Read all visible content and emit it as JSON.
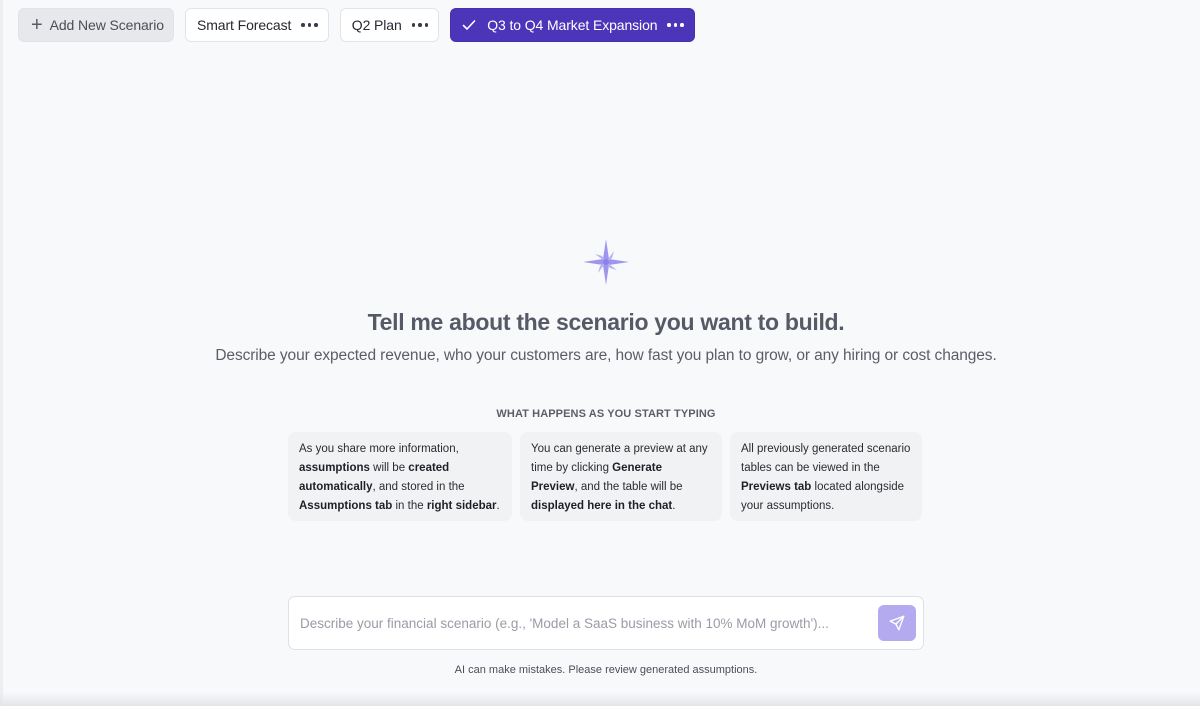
{
  "tabs": {
    "add_label": "Add New Scenario",
    "items": [
      {
        "label": "Smart Forecast",
        "active": false
      },
      {
        "label": "Q2 Plan",
        "active": false
      },
      {
        "label": "Q3 to Q4 Market Expansion",
        "active": true
      }
    ]
  },
  "empty_state": {
    "icon": "sparkle-icon",
    "title": "Tell me about the scenario you want to build.",
    "subtitle": "Describe your expected revenue, who your customers are, how fast you plan to grow, or any hiring or cost changes.",
    "section_label": "WHAT HAPPENS AS YOU START TYPING",
    "cards": [
      {
        "segments": [
          {
            "text": "As you share more information, ",
            "bold": false
          },
          {
            "text": "assumptions",
            "bold": true
          },
          {
            "text": " will be ",
            "bold": false
          },
          {
            "text": "created automatically",
            "bold": true
          },
          {
            "text": ", and stored in the ",
            "bold": false
          },
          {
            "text": "Assumptions tab",
            "bold": true
          },
          {
            "text": " in the ",
            "bold": false
          },
          {
            "text": "right sidebar",
            "bold": true
          },
          {
            "text": ".",
            "bold": false
          }
        ]
      },
      {
        "segments": [
          {
            "text": "You can generate a preview at any time by clicking ",
            "bold": false
          },
          {
            "text": "Generate Preview",
            "bold": true
          },
          {
            "text": ", and the table will be ",
            "bold": false
          },
          {
            "text": "displayed here in the chat",
            "bold": true
          },
          {
            "text": ".",
            "bold": false
          }
        ]
      },
      {
        "segments": [
          {
            "text": "All previously generated scenario tables can be viewed in the ",
            "bold": false
          },
          {
            "text": "Previews tab",
            "bold": true
          },
          {
            "text": " located alongside your assumptions.",
            "bold": false
          }
        ]
      }
    ]
  },
  "composer": {
    "placeholder": "Describe your financial scenario (e.g., 'Model a SaaS business with 10% MoM growth')...",
    "value": "",
    "send_icon": "send-icon",
    "disclaimer": "AI can make mistakes. Please review generated assumptions."
  },
  "colors": {
    "accent": "#4c35b8",
    "send_button": "#b3aaf0",
    "sparkle": "#9e96ee",
    "background": "#f8f9fb"
  }
}
